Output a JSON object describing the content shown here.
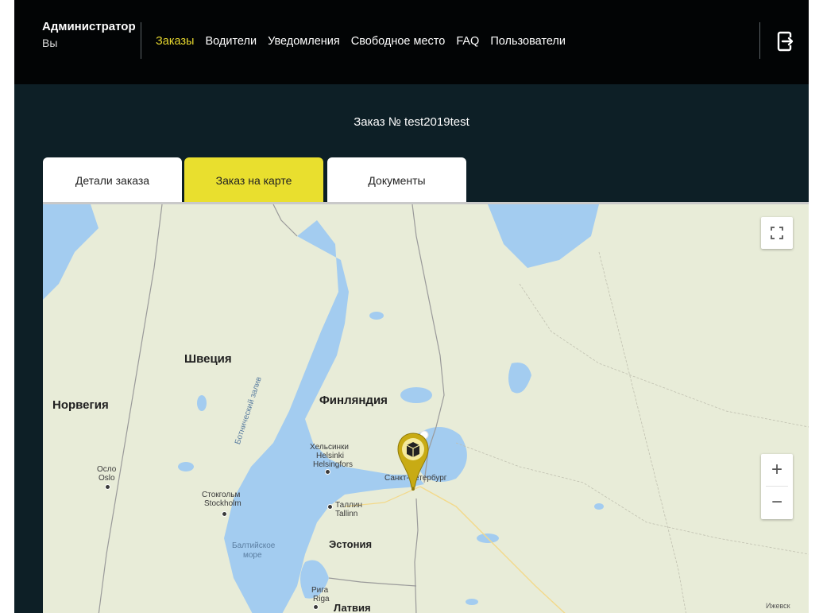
{
  "header": {
    "user_name": "Администратор",
    "user_role": "Вы",
    "nav": [
      {
        "label": "Заказы",
        "active": true
      },
      {
        "label": "Водители",
        "active": false
      },
      {
        "label": "Уведомления",
        "active": false
      },
      {
        "label": "Свободное место",
        "active": false
      },
      {
        "label": "FAQ",
        "active": false
      },
      {
        "label": "Пользователи",
        "active": false
      }
    ],
    "logout_icon": "logout-icon"
  },
  "order": {
    "title": "Заказ № test2019test"
  },
  "tabs": [
    {
      "label": "Детали заказа",
      "active": false
    },
    {
      "label": "Заказ на карте",
      "active": true
    },
    {
      "label": "Документы",
      "active": false
    }
  ],
  "map": {
    "labels": {
      "sweden": "Швеция",
      "norway": "Норвегия",
      "finland": "Финляндия",
      "estonia": "Эстония",
      "latvia": "Латвия",
      "helsinki_ru": "Хельсинки",
      "helsinki_fi": "Helsinki",
      "helsinki_sv": "Helsingfors",
      "oslo_ru": "Осло",
      "oslo": "Oslo",
      "stockholm_ru": "Стокгольм",
      "stockholm": "Stockholm",
      "tallinn_ru": "Таллин",
      "tallinn": "Tallinn",
      "riga_ru": "Рига",
      "riga": "Riga",
      "spb": "Санкт-Петербург",
      "baltic_sea_1": "Балтийское",
      "baltic_sea_2": "море",
      "gulf_bothnia": "Ботнический залив",
      "izhevsk": "Ижевск"
    },
    "zoom_in": "+",
    "zoom_out": "−",
    "fullscreen_icon": "fullscreen-icon",
    "marker_icon": "package-marker-icon",
    "colors": {
      "water": "#a3ccf0",
      "land": "#e8ecd8",
      "accent": "#e9df2e",
      "header": "#020405",
      "background": "#0d1f26"
    }
  }
}
